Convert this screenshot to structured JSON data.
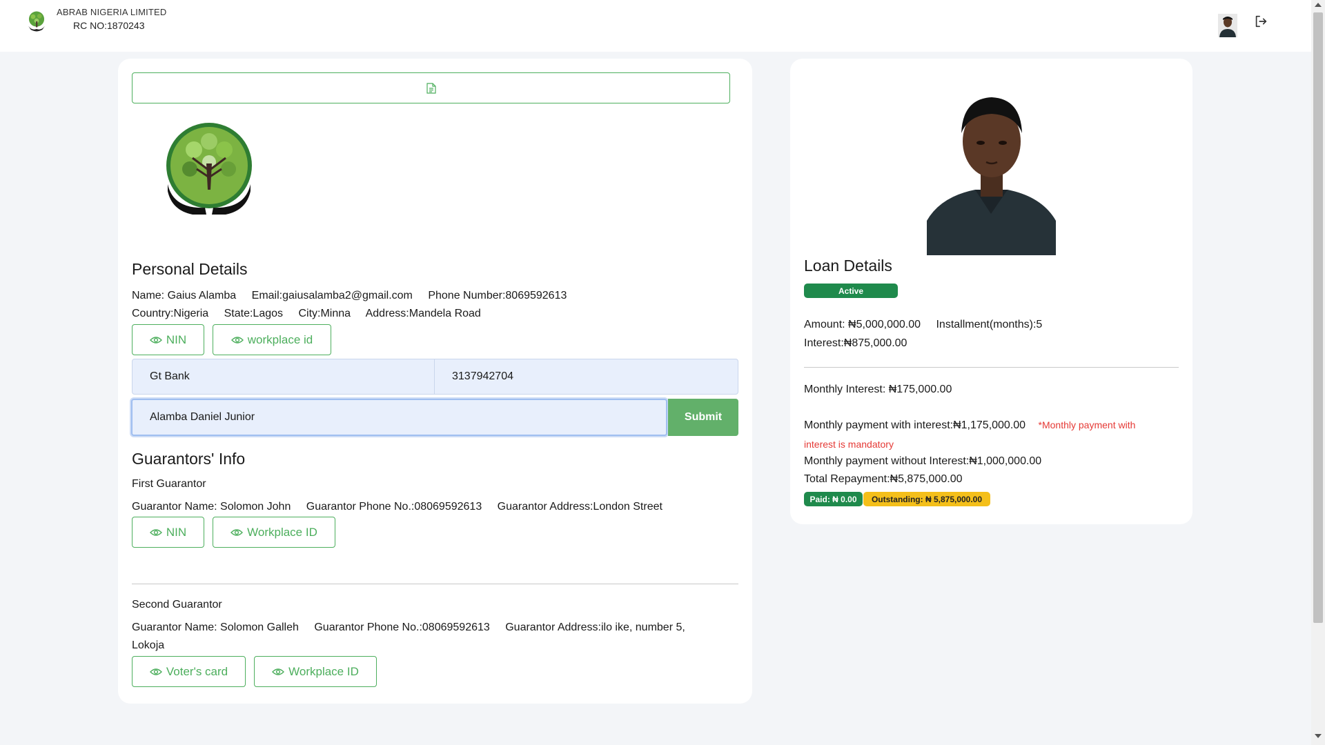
{
  "header": {
    "company_name": "ABRAB NIGERIA LIMITED",
    "rc_number": "RC NO:1870243",
    "logo_icon": "tree-hands-logo-icon",
    "avatar_icon": "user-avatar-icon",
    "logout_icon": "logout-icon"
  },
  "left_card": {
    "file_icon": "document-icon",
    "personal": {
      "title": "Personal Details",
      "name": "Name: Gaius Alamba",
      "email": "Email:gaiusalamba2@gmail.com",
      "phone": "Phone Number:8069592613",
      "country": "Country:Nigeria",
      "state": "State:Lagos",
      "city": "City:Minna",
      "address": "Address:Mandela Road",
      "btn_nin": "NIN",
      "btn_workplace": "workplace id"
    },
    "bank": {
      "bank_name": "Gt Bank",
      "account_number": "3137942704",
      "account_name": "Alamba Daniel Junior",
      "submit_label": "Submit"
    },
    "guarantors": {
      "title": "Guarantors' Info",
      "first": {
        "heading": "First Guarantor",
        "name": "Guarantor Name: Solomon John",
        "phone": "Guarantor Phone No.:08069592613",
        "address": "Guarantor Address:London Street",
        "btn_id": "NIN",
        "btn_workplace": "Workplace ID"
      },
      "second": {
        "heading": "Second Guarantor",
        "name": "Guarantor Name: Solomon Galleh",
        "phone": "Guarantor Phone No.:08069592613",
        "address": "Guarantor Address:ilo ike, number 5,",
        "address_cont": "Lokoja",
        "btn_id": "Voter's card",
        "btn_workplace": "Workplace ID"
      }
    }
  },
  "right_card": {
    "title": "Loan Details",
    "status": "Active",
    "amount": "Amount: ₦5,000,000.00",
    "installment": "Installment(months):5",
    "interest": "Interest:₦875,000.00",
    "monthly_interest": "Monthly Interest: ₦175,000.00",
    "monthly_with_interest": "Monthly payment with interest:₦1,175,000.00",
    "mandatory_note_1": "*Monthly payment with",
    "mandatory_note_2": "interest is mandatory",
    "monthly_without_interest": "Monthly payment without Interest:₦1,000,000.00",
    "total_repayment": "Total Repayment:₦5,875,000.00",
    "paid": "Paid: ₦ 0.00",
    "outstanding": "Outstanding: ₦ 5,875,000.00"
  },
  "colors": {
    "accent_green": "#4cae5c",
    "submit_green": "#62b06a",
    "active_badge": "#1f8a4c",
    "outstanding_badge": "#f4bf1a",
    "input_bg": "#e8effc",
    "note_red": "#e53935"
  }
}
